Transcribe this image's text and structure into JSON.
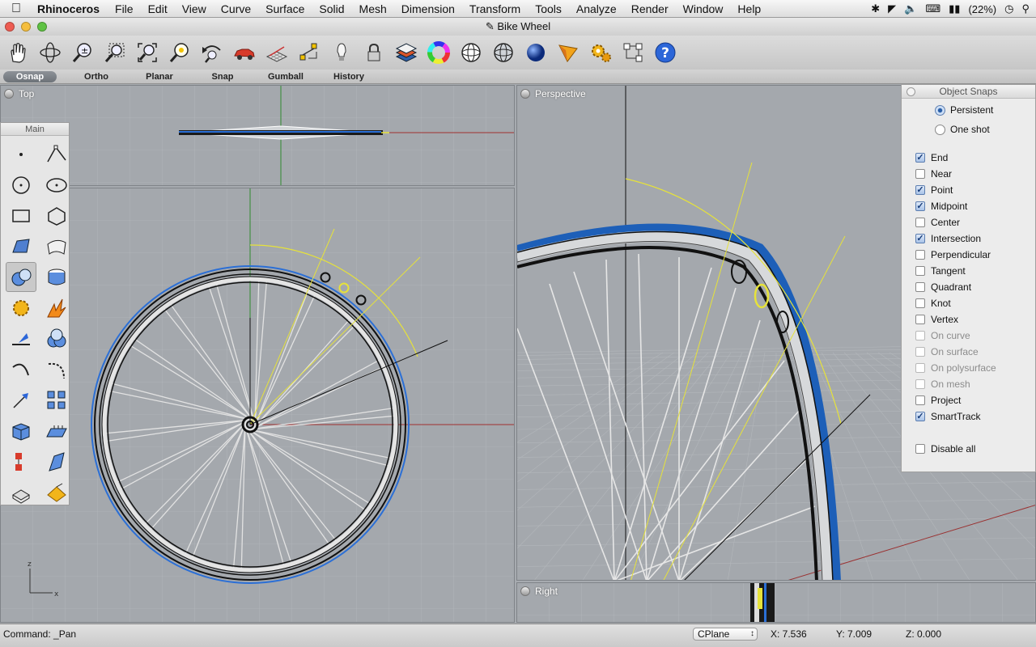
{
  "menubar": {
    "app_name": "Rhinoceros",
    "items": [
      "File",
      "Edit",
      "View",
      "Curve",
      "Surface",
      "Solid",
      "Mesh",
      "Dimension",
      "Transform",
      "Tools",
      "Analyze",
      "Render",
      "Window",
      "Help"
    ],
    "battery": "(22%)"
  },
  "window": {
    "title": "Bike Wheel"
  },
  "toolbar": {
    "icons": [
      "pan-hand-icon",
      "rotate-view-icon",
      "zoom-in-icon",
      "zoom-window-icon",
      "zoom-extents-icon",
      "zoom-selected-icon",
      "undo-view-icon",
      "car-icon",
      "grid-plane-icon",
      "osnap-icon",
      "light-bulb-icon",
      "lock-icon",
      "layers-icon",
      "color-wheel-icon",
      "sphere-wireframe-icon",
      "sphere-shaded-icon",
      "sphere-render-icon",
      "render-cone-icon",
      "gears-icon",
      "connect-icon",
      "help-icon"
    ]
  },
  "modes": [
    "Osnap",
    "Ortho",
    "Planar",
    "Snap",
    "Gumball",
    "History"
  ],
  "viewports": {
    "top": "Top",
    "perspective": "Perspective",
    "right": "Right"
  },
  "palette": {
    "title": "Main"
  },
  "axis_labels": {
    "z": "z",
    "x": "x"
  },
  "osnap": {
    "title": "Object Snaps",
    "persistent": "Persistent",
    "one_shot": "One shot",
    "items": [
      {
        "label": "End",
        "checked": true,
        "disabled": false
      },
      {
        "label": "Near",
        "checked": false,
        "disabled": false
      },
      {
        "label": "Point",
        "checked": true,
        "disabled": false
      },
      {
        "label": "Midpoint",
        "checked": true,
        "disabled": false
      },
      {
        "label": "Center",
        "checked": false,
        "disabled": false
      },
      {
        "label": "Intersection",
        "checked": true,
        "disabled": false
      },
      {
        "label": "Perpendicular",
        "checked": false,
        "disabled": false
      },
      {
        "label": "Tangent",
        "checked": false,
        "disabled": false
      },
      {
        "label": "Quadrant",
        "checked": false,
        "disabled": false
      },
      {
        "label": "Knot",
        "checked": false,
        "disabled": false
      },
      {
        "label": "Vertex",
        "checked": false,
        "disabled": false
      },
      {
        "label": "On curve",
        "checked": false,
        "disabled": true
      },
      {
        "label": "On surface",
        "checked": false,
        "disabled": true
      },
      {
        "label": "On polysurface",
        "checked": false,
        "disabled": true
      },
      {
        "label": "On mesh",
        "checked": false,
        "disabled": true
      },
      {
        "label": "Project",
        "checked": false,
        "disabled": false
      },
      {
        "label": "SmartTrack",
        "checked": true,
        "disabled": false
      }
    ],
    "disable_all": "Disable all"
  },
  "statusbar": {
    "command": "Command: _Pan",
    "cplane": "CPlane",
    "x": "X: 7.536",
    "y": "Y: 7.009",
    "z": "Z: 0.000"
  }
}
